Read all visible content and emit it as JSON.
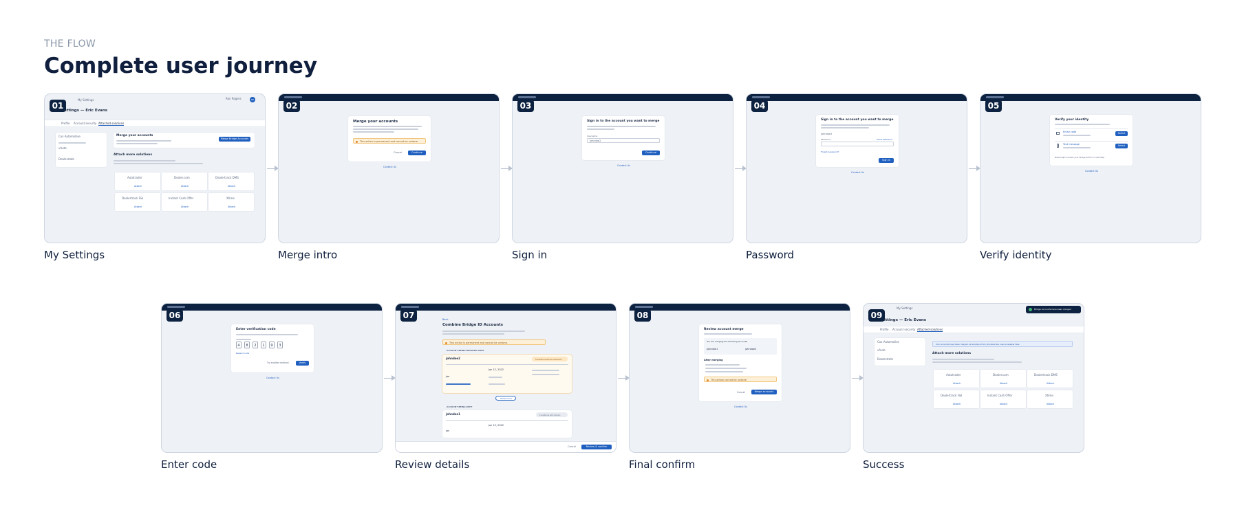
{
  "header": {
    "eyebrow": "THE FLOW",
    "title": "Complete user journey"
  },
  "steps": [
    {
      "number": "01",
      "caption": "My Settings"
    },
    {
      "number": "02",
      "caption": "Merge intro"
    },
    {
      "number": "03",
      "caption": "Sign in"
    },
    {
      "number": "04",
      "caption": "Password"
    },
    {
      "number": "05",
      "caption": "Verify identity"
    },
    {
      "number": "06",
      "caption": "Enter code"
    },
    {
      "number": "07",
      "caption": "Review details"
    },
    {
      "number": "08",
      "caption": "Final confirm"
    },
    {
      "number": "09",
      "caption": "Success"
    }
  ],
  "screens": {
    "s1": {
      "top_link": "My Settings",
      "user_name": "Ron Rogers",
      "avatar": "RR",
      "page_title": "Settings — Eric Evans",
      "tabs": [
        "Profile",
        "Account security",
        "Attached solutions"
      ],
      "side_items": [
        "Cox Automotive",
        "vAuto",
        "Dealerstats"
      ],
      "merge_title": "Merge your accounts",
      "merge_button": "Merge Bridge Accounts",
      "attach_title": "Attach more solutions",
      "tiles": [
        "Autotrader",
        "Dealer.com",
        "Dealertrack DMS",
        "Dealertrack F&I",
        "Instant Cash Offer",
        "Xtime"
      ],
      "tile_link": "Attach"
    },
    "s2": {
      "title": "Merge your accounts",
      "warning": "This action is permanent and cannot be undone.",
      "cancel": "Cancel",
      "continue": "Continue",
      "footer": "Contact Us"
    },
    "s3": {
      "title": "Sign in to the account you want to merge",
      "field_label": "Username",
      "field_value": "johndoe2",
      "continue": "Continue",
      "footer": "Contact Us"
    },
    "s4": {
      "title": "Sign in to the account you want to merge",
      "username": "johndoe2",
      "field_label": "Password",
      "show": "Show Password",
      "forgot": "Forgot password?",
      "sign_in": "Sign In",
      "footer": "Contact Us"
    },
    "s5": {
      "title": "Verify your identity",
      "opt1": "Email code",
      "opt2": "Text message",
      "select": "Select",
      "help": "Need help? Contact your Bridge admin or visit Help",
      "footer": "Contact Us"
    },
    "s6": {
      "title": "Enter verification code",
      "digits": [
        "4",
        "8",
        "2",
        "1",
        "9",
        "3"
      ],
      "resend": "Resend code",
      "another": "Try another method",
      "verify": "Verify",
      "footer": "Contact Us"
    },
    "s7": {
      "back": "Back",
      "title": "Combine Bridge ID Accounts",
      "warning": "This action is permanent and cannot be undone.",
      "kept_header": "ACCOUNT BEING BRIDGED AWAY",
      "kept_user": "johndoe2",
      "kept_pill": "5 solutions will be removed",
      "kept_name": "Joe",
      "kept_date": "Jan 12, 2022",
      "merged_header": "ACCOUNT BEING KEPT",
      "merged_user": "johndoe1",
      "merged_pill": "2 solutions will remain",
      "merged_name": "Jon",
      "merged_date": "Jan 12, 2022",
      "show_more": "Show more",
      "cancel": "Cancel",
      "confirm": "Review & confirm"
    },
    "s8": {
      "title": "Review account merge",
      "merging": "You are merging the following accounts",
      "acct1": "johndoe1",
      "acct2": "johndoe2",
      "after": "After merging",
      "warning": "This action cannot be undone",
      "cancel": "Cancel",
      "merge": "Merge accounts",
      "footer": "Contact Us"
    },
    "s9": {
      "top_link": "My Settings",
      "toast": "Bridge Accounts have been merged",
      "page_title": "Settings — Eric Evans",
      "tabs": [
        "Profile",
        "Account security",
        "Attached solutions"
      ],
      "side_items": [
        "Cox Automotive",
        "vAuto",
        "Dealerstats"
      ],
      "banner": "Your accounts have been merged. All solutions from johndoe2 are now accessible here.",
      "attach_title": "Attach more solutions",
      "tiles": [
        "Autotrader",
        "Dealer.com",
        "Dealertrack DMS",
        "Dealertrack F&I",
        "Instant Cash Offer",
        "Xtime"
      ],
      "tile_link": "Attach"
    }
  },
  "colors": {
    "navy": "#0d2240",
    "accent": "#1f5fbf",
    "canvas": "#eef1f5",
    "warning": "#fdf0d8"
  }
}
